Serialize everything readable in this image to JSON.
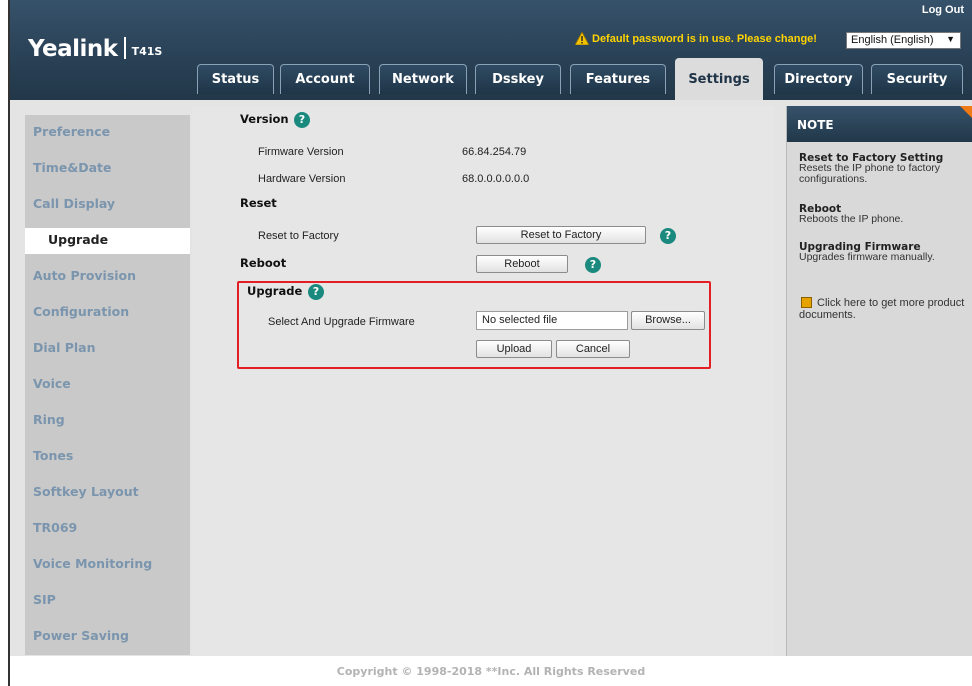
{
  "header": {
    "logo": "Yealink",
    "model": "T41S",
    "logout": "Log Out",
    "warning": "Default password is in use. Please change!",
    "language": "English (English)"
  },
  "tabs": [
    {
      "label": "Status"
    },
    {
      "label": "Account"
    },
    {
      "label": "Network"
    },
    {
      "label": "Dsskey"
    },
    {
      "label": "Features"
    },
    {
      "label": "Settings"
    },
    {
      "label": "Directory"
    },
    {
      "label": "Security"
    }
  ],
  "active_tab": "Settings",
  "sidebar": {
    "items": [
      {
        "label": "Preference"
      },
      {
        "label": "Time&Date"
      },
      {
        "label": "Call Display"
      },
      {
        "label": "Upgrade"
      },
      {
        "label": "Auto Provision"
      },
      {
        "label": "Configuration"
      },
      {
        "label": "Dial Plan"
      },
      {
        "label": "Voice"
      },
      {
        "label": "Ring"
      },
      {
        "label": "Tones"
      },
      {
        "label": "Softkey Layout"
      },
      {
        "label": "TR069"
      },
      {
        "label": "Voice Monitoring"
      },
      {
        "label": "SIP"
      },
      {
        "label": "Power Saving"
      }
    ],
    "active": "Upgrade"
  },
  "main": {
    "version": {
      "title": "Version",
      "firmware_label": "Firmware Version",
      "firmware_value": "66.84.254.79",
      "hardware_label": "Hardware Version",
      "hardware_value": "68.0.0.0.0.0.0"
    },
    "reset": {
      "title": "Reset",
      "label": "Reset to Factory",
      "button": "Reset to Factory"
    },
    "reboot": {
      "title": "Reboot",
      "button": "Reboot"
    },
    "upgrade": {
      "title": "Upgrade",
      "label": "Select And Upgrade Firmware",
      "file_value": "No selected file",
      "browse": "Browse...",
      "upload": "Upload",
      "cancel": "Cancel"
    },
    "help_glyph": "?"
  },
  "note": {
    "title": "NOTE",
    "reset_title": "Reset to Factory Setting",
    "reset_text": "Resets the IP phone to factory configurations.",
    "reboot_title": "Reboot",
    "reboot_text": "Reboots the IP phone.",
    "upgrade_title": "Upgrading Firmware",
    "upgrade_text": "Upgrades firmware manually.",
    "doc_link": "Click here to get more product documents."
  },
  "footer": "Copyright © 1998-2018 **Inc. All Rights Reserved",
  "colors": {
    "header_dark": "#223849",
    "nav_text": "#7a95ad",
    "highlight_box": "#e31e24",
    "help_icon": "#1b8a7e",
    "note_corner": "#f07b14",
    "warning_text": "#ffd400"
  }
}
